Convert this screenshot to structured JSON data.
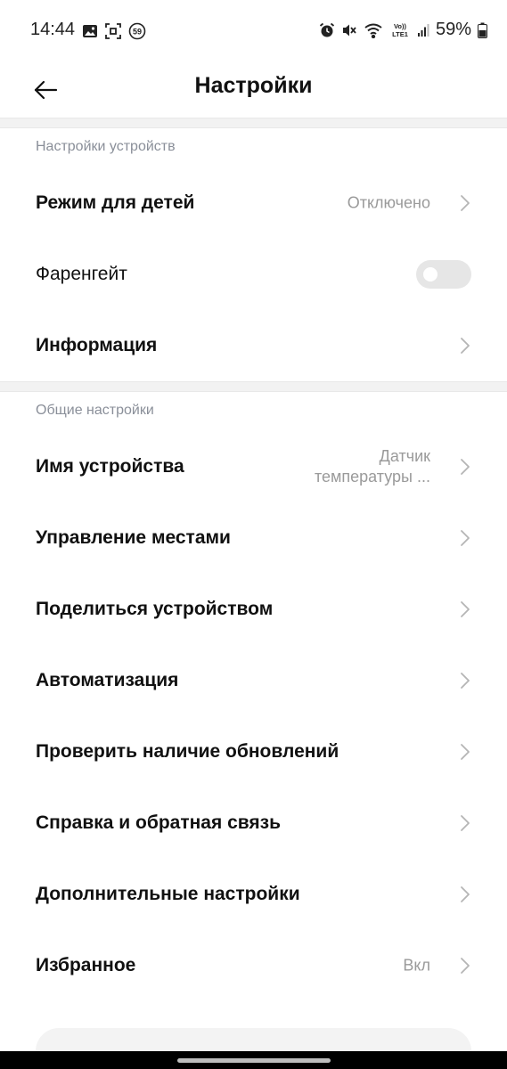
{
  "status_bar": {
    "time": "14:44",
    "battery": "59%",
    "notif_badge": "59",
    "volte_label": "Vo)) LTE1",
    "icons_left": [
      "image-icon",
      "screenshot-icon",
      "badge-59-icon"
    ],
    "icons_right": [
      "alarm-icon",
      "mute-icon",
      "wifi-icon",
      "volte-icon",
      "signal-icon",
      "battery-icon"
    ]
  },
  "header": {
    "title": "Настройки",
    "back_icon": "arrow-left-icon"
  },
  "sections": {
    "device": {
      "title": "Настройки устройств",
      "kids_mode": {
        "label": "Режим для детей",
        "value": "Отключено"
      },
      "fahrenheit": {
        "label": "Фаренгейт",
        "toggle_on": false
      },
      "info": {
        "label": "Информация"
      }
    },
    "general": {
      "title": "Общие настройки",
      "device_name": {
        "label": "Имя устройства",
        "value_line1": "Датчик",
        "value_line2": "температуры ..."
      },
      "manage_locations": {
        "label": "Управление местами"
      },
      "share_device": {
        "label": "Поделиться устройством"
      },
      "automation": {
        "label": "Автоматизация"
      },
      "check_updates": {
        "label": "Проверить наличие обновлений"
      },
      "help_feedback": {
        "label": "Справка и обратная связь"
      },
      "advanced": {
        "label": "Дополнительные настройки"
      },
      "favorites": {
        "label": "Избранное",
        "value": "Вкл"
      }
    }
  },
  "colors": {
    "accent_red": "#e0393e",
    "section_title": "#8a8f99",
    "value_gray": "#9a9a9a",
    "toggle_off": "#e6e6e6"
  }
}
